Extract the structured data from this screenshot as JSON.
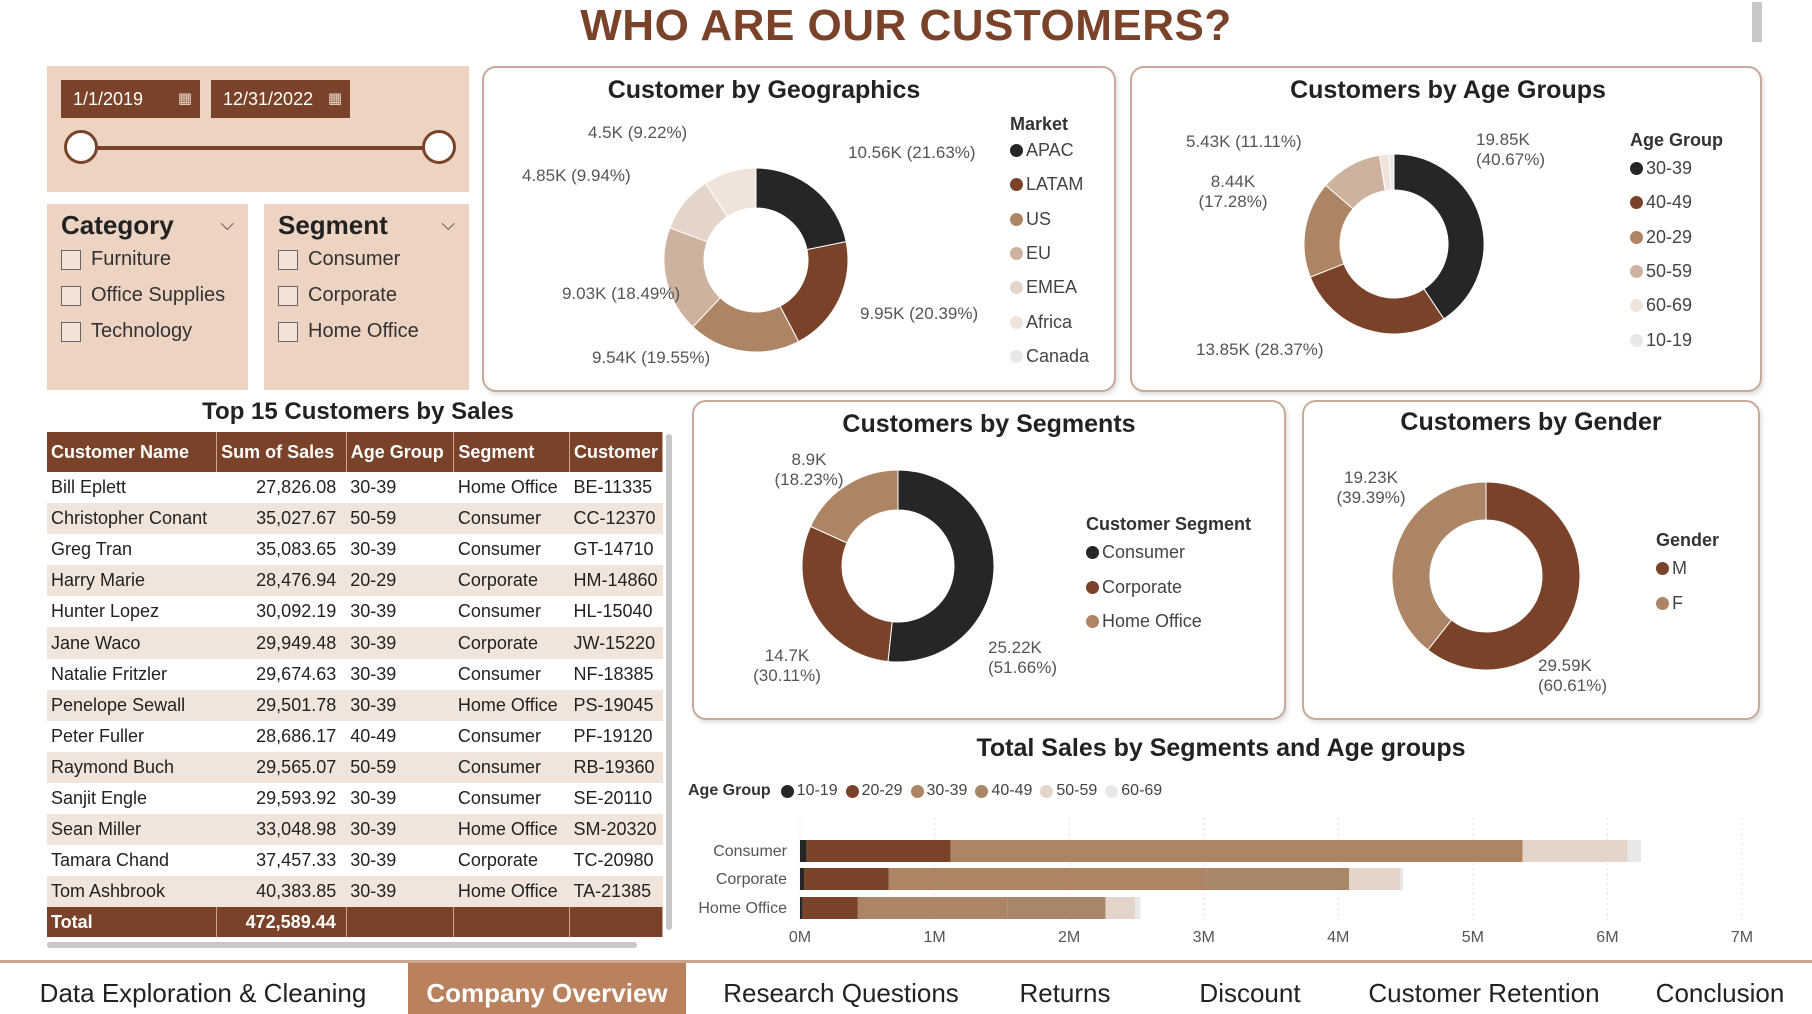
{
  "page_title": "WHO ARE OUR CUSTOMERS?",
  "date_filter": {
    "start": "1/1/2019",
    "end": "12/31/2022",
    "calendar_icon": "calendar-icon"
  },
  "category_slicer": {
    "title": "Category",
    "options": [
      "Furniture",
      "Office Supplies",
      "Technology"
    ]
  },
  "segment_slicer": {
    "title": "Segment",
    "options": [
      "Consumer",
      "Corporate",
      "Home Office"
    ]
  },
  "colors": {
    "c1": "#262626",
    "c2": "#7a4228",
    "c3": "#ae8564",
    "c4": "#cdb29f",
    "c5": "#e4d5cb",
    "c6": "#efe3da",
    "c7": "#e8e8e8",
    "header": "#7a4228",
    "panel": "#ecd3c2"
  },
  "top_customers": {
    "title": "Top 15 Customers by Sales",
    "columns": [
      "Customer Name",
      "Sum of Sales",
      "Age Group",
      "Segment",
      "Customer"
    ],
    "rows": [
      [
        "Bill Eplett",
        "27,826.08",
        "30-39",
        "Home Office",
        "BE-11335"
      ],
      [
        "Christopher Conant",
        "35,027.67",
        "50-59",
        "Consumer",
        "CC-12370"
      ],
      [
        "Greg Tran",
        "35,083.65",
        "30-39",
        "Consumer",
        "GT-14710"
      ],
      [
        "Harry Marie",
        "28,476.94",
        "20-29",
        "Corporate",
        "HM-14860"
      ],
      [
        "Hunter Lopez",
        "30,092.19",
        "30-39",
        "Consumer",
        "HL-15040"
      ],
      [
        "Jane Waco",
        "29,949.48",
        "30-39",
        "Corporate",
        "JW-15220"
      ],
      [
        "Natalie Fritzler",
        "29,674.63",
        "30-39",
        "Consumer",
        "NF-18385"
      ],
      [
        "Penelope Sewall",
        "29,501.78",
        "30-39",
        "Home Office",
        "PS-19045"
      ],
      [
        "Peter Fuller",
        "28,686.17",
        "40-49",
        "Consumer",
        "PF-19120"
      ],
      [
        "Raymond Buch",
        "29,565.07",
        "50-59",
        "Consumer",
        "RB-19360"
      ],
      [
        "Sanjit Engle",
        "29,593.92",
        "30-39",
        "Consumer",
        "SE-20110"
      ],
      [
        "Sean Miller",
        "33,048.98",
        "30-39",
        "Home Office",
        "SM-20320"
      ],
      [
        "Tamara Chand",
        "37,457.33",
        "30-39",
        "Corporate",
        "TC-20980"
      ],
      [
        "Tom Ashbrook",
        "40,383.85",
        "30-39",
        "Home Office",
        "TA-21385"
      ]
    ],
    "total_label": "Total",
    "total_value": "472,589.44"
  },
  "chart_data": [
    {
      "type": "pie",
      "title": "Customer by Geographics",
      "legend_title": "Market",
      "categories": [
        "APAC",
        "LATAM",
        "US",
        "EU",
        "EMEA",
        "Africa",
        "Canada"
      ],
      "values": [
        10.56,
        9.95,
        9.54,
        9.03,
        4.85,
        4.5,
        0
      ],
      "labels": [
        "10.56K (21.63%)",
        "9.95K (20.39%)",
        "9.54K (19.55%)",
        "9.03K (18.49%)",
        "4.85K (9.94%)",
        "4.5K (9.22%)",
        ""
      ],
      "colors": [
        "#262626",
        "#7a4228",
        "#ae8564",
        "#cdb29f",
        "#e4d5cb",
        "#efe3da",
        "#e8e8e8"
      ],
      "legend": "right"
    },
    {
      "type": "pie",
      "title": "Customers by Age Groups",
      "legend_title": "Age Group",
      "categories": [
        "30-39",
        "40-49",
        "20-29",
        "50-59",
        "60-69",
        "10-19"
      ],
      "values": [
        19.85,
        13.85,
        8.44,
        5.43,
        0.82,
        0.44
      ],
      "labels": [
        "19.85K (40.67%)",
        "13.85K (28.37%)",
        "8.44K (17.28%)",
        "5.43K (11.11%)",
        "",
        ""
      ],
      "colors": [
        "#262626",
        "#7a4228",
        "#ae8564",
        "#cdb29f",
        "#efe3da",
        "#e8e8e8"
      ],
      "legend": "right"
    },
    {
      "type": "pie",
      "title": "Customers by Segments",
      "legend_title": "Customer Segment",
      "categories": [
        "Consumer",
        "Corporate",
        "Home Office"
      ],
      "values": [
        25.22,
        14.7,
        8.9
      ],
      "labels": [
        "25.22K (51.66%)",
        "14.7K (30.11%)",
        "8.9K (18.23%)"
      ],
      "colors": [
        "#262626",
        "#7a4228",
        "#ae8564"
      ],
      "legend": "right"
    },
    {
      "type": "pie",
      "title": "Customers by Gender",
      "legend_title": "Gender",
      "categories": [
        "M",
        "F"
      ],
      "values": [
        29.59,
        19.23
      ],
      "labels": [
        "29.59K (60.61%)",
        "19.23K (39.39%)"
      ],
      "colors": [
        "#7a4228",
        "#ae8564"
      ],
      "legend": "right"
    },
    {
      "type": "bar",
      "orientation": "horizontal",
      "stacked": true,
      "title": "Total Sales by Segments and Age groups",
      "legend_title": "Age Group",
      "categories": [
        "Consumer",
        "Corporate",
        "Home Office"
      ],
      "series": [
        {
          "name": "10-19",
          "values": [
            0.05,
            0.03,
            0.02
          ]
        },
        {
          "name": "20-29",
          "values": [
            1.07,
            0.63,
            0.41
          ]
        },
        {
          "name": "30-39",
          "values": [
            4.25,
            2.36,
            1.11
          ]
        },
        {
          "name": "40-49",
          "values": [
            0,
            1.06,
            0.73
          ]
        },
        {
          "name": "50-59",
          "values": [
            0.78,
            0.38,
            0.22
          ]
        },
        {
          "name": "60-69",
          "values": [
            0.1,
            0.02,
            0.04
          ]
        }
      ],
      "colors": [
        "#262626",
        "#7a4228",
        "#ae8564",
        "#a98667",
        "#e4d5cb",
        "#e8e8e8"
      ],
      "xlim": [
        0,
        7
      ],
      "xticks": [
        "0M",
        "1M",
        "2M",
        "3M",
        "4M",
        "5M",
        "6M",
        "7M"
      ],
      "legend": "top-left"
    }
  ],
  "nav": {
    "items": [
      "Data Exploration & Cleaning",
      "Company Overview",
      "Research Questions",
      "Returns",
      "Discount",
      "Customer Retention",
      "Conclusion"
    ],
    "active": "Company Overview"
  }
}
